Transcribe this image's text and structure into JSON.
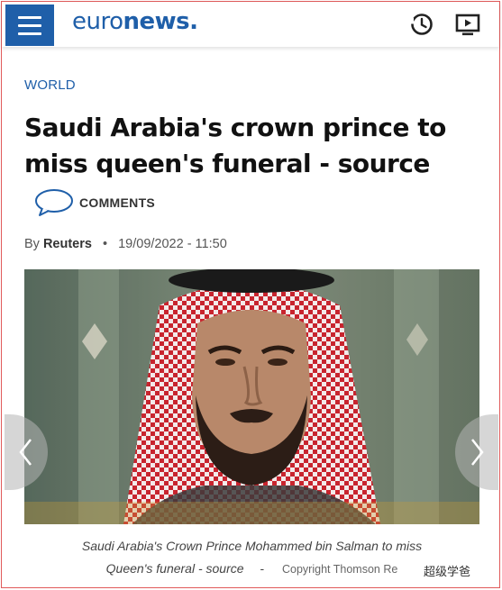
{
  "header": {
    "logo_light": "euro",
    "logo_bold": "news",
    "logo_suffix": ".",
    "menu_icon": "hamburger-menu-icon",
    "latest_icon": "clock-latest-icon",
    "live_icon": "live-tv-icon",
    "brand_color": "#1f5fa9"
  },
  "article": {
    "section": "WORLD",
    "headline": "Saudi Arabia's crown prince to miss queen's funeral - source",
    "comments_label": "COMMENTS",
    "byline_prefix": "By",
    "author": "Reuters",
    "bullet": "•",
    "timestamp": "19/09/2022 - 11:50",
    "caption_line1": "Saudi Arabia's Crown Prince Mohammed bin Salman to miss",
    "caption_line2": "Queen's funeral - source",
    "caption_dash": "-",
    "copyright": "Copyright  Thomson Re",
    "watermark": "超级学爸"
  }
}
